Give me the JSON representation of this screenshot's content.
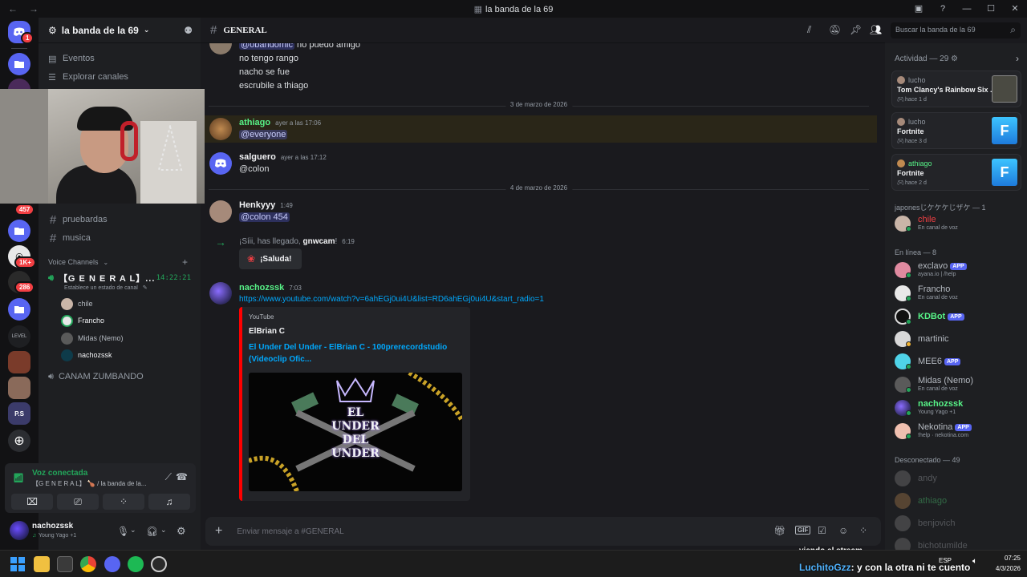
{
  "window": {
    "title": "la banda de la 69"
  },
  "rail": {
    "home_badge": "1",
    "badge_a": "457",
    "badge_b": "1K+",
    "badge_c": "286",
    "level_label": "LEVEL",
    "ps_label": "P.S"
  },
  "server": {
    "name": "la banda de la 69"
  },
  "sidebar": {
    "events": "Eventos",
    "browse": "Explorar canales",
    "text_channels": [
      "pruebardas",
      "musica"
    ],
    "voice_header": "Voice Channels",
    "voice_channel": "【G E N E R A L】...",
    "voice_timer": "14:22:21",
    "voice_status_hint": "Establece un estado de canal",
    "voice_users": [
      "chile",
      "Francho",
      "Midas (Nemo)",
      "nachozssk"
    ],
    "voice_channel_2": "CANAM ZUMBANDO"
  },
  "voice_panel": {
    "status": "Voz conectada",
    "location": "【G E N E R A L】 🍗 / la banda de la..."
  },
  "user_panel": {
    "name": "nachozssk",
    "activity": "Young Yago +1"
  },
  "channel": {
    "name": "GENERAL"
  },
  "search": {
    "placeholder": "Buscar la banda de la 69"
  },
  "messages": {
    "m0_mention": "@obandomic",
    "m0_text": "no puedo amigo",
    "m1": "no tengo rango",
    "m2": "nacho se fue",
    "m3": "escrubile a thiago",
    "date1": "3 de marzo de 2026",
    "athiago_name": "athiago",
    "athiago_time": "ayer a las 17:06",
    "athiago_text": "@everyone",
    "salguero_name": "salguero",
    "salguero_time": "ayer a las 17:12",
    "salguero_text": "@colon",
    "date2": "4 de marzo de 2026",
    "henk_name": "Henkyyy",
    "henk_time": "1:49",
    "henk_text": "@colon 454",
    "join_prefix": "¡Síii, has llegado,",
    "join_user": "gnwcam",
    "join_suffix": "!",
    "join_time": "6:19",
    "wave_button": "¡Saluda!",
    "nacho_name": "nachozssk",
    "nacho_time": "7:03",
    "link": "https://www.youtube.com/watch?v=6ahEGj0ui4U&list=RD6ahEGj0ui4U&start_radio=1",
    "embed_provider": "YouTube",
    "embed_author": "ElBrian C",
    "embed_title": "El Under Del Under - ElBrian C - 100prerecordstudio (Videoclip Ofic...",
    "thumb_text": [
      "EL",
      "UNDER",
      "DEL",
      "UNDER"
    ]
  },
  "composer": {
    "placeholder": "Enviar mensaje a #GENERAL"
  },
  "members": {
    "activity_header": "Actividad — 29",
    "activities": [
      {
        "user": "lucho",
        "game": "Tom Clancy's Rainbow Six ...",
        "ago": "hace 1 d"
      },
      {
        "user": "lucho",
        "game": "Fortnite",
        "ago": "hace 3 d"
      },
      {
        "user": "athiago",
        "game": "Fortnite",
        "ago": "hace 2 d"
      }
    ],
    "role_header": "japonesじケケケじザケ — 1",
    "role_member": {
      "name": "chile",
      "status": "En canal de voz"
    },
    "online_header": "En línea — 8",
    "online": [
      {
        "name": "exclavo",
        "status": "ayana.io | /help",
        "app": "APP"
      },
      {
        "name": "Francho",
        "status": "En canal de voz"
      },
      {
        "name": "KDBot",
        "status": "",
        "app": "APP"
      },
      {
        "name": "martinic",
        "status": ""
      },
      {
        "name": "MEE6",
        "status": "",
        "app": "APP"
      },
      {
        "name": "Midas (Nemo)",
        "status": "En canal de voz"
      },
      {
        "name": "nachozssk",
        "status": "Young Yago +1"
      },
      {
        "name": "Nekotina",
        "status": "!help · nekotina.com",
        "app": "APP"
      }
    ],
    "offline_header": "Desconectado — 49",
    "offline": [
      "andy",
      "athiago",
      "benjovich",
      "bichotumilde"
    ]
  },
  "stream_overlay": {
    "top_text": "viendo el stream",
    "user": "LuchitoGzz",
    "text": ": y con la otra ni te cuento"
  },
  "taskbar": {
    "lang": "ESP",
    "time": "07:25",
    "date": "4/3/2026"
  },
  "colors": {
    "accent": "#5865f2",
    "online": "#23a55a",
    "mention_bg": "#3c3f70",
    "link": "#00a8fc",
    "youtube_red": "#ff0000"
  }
}
